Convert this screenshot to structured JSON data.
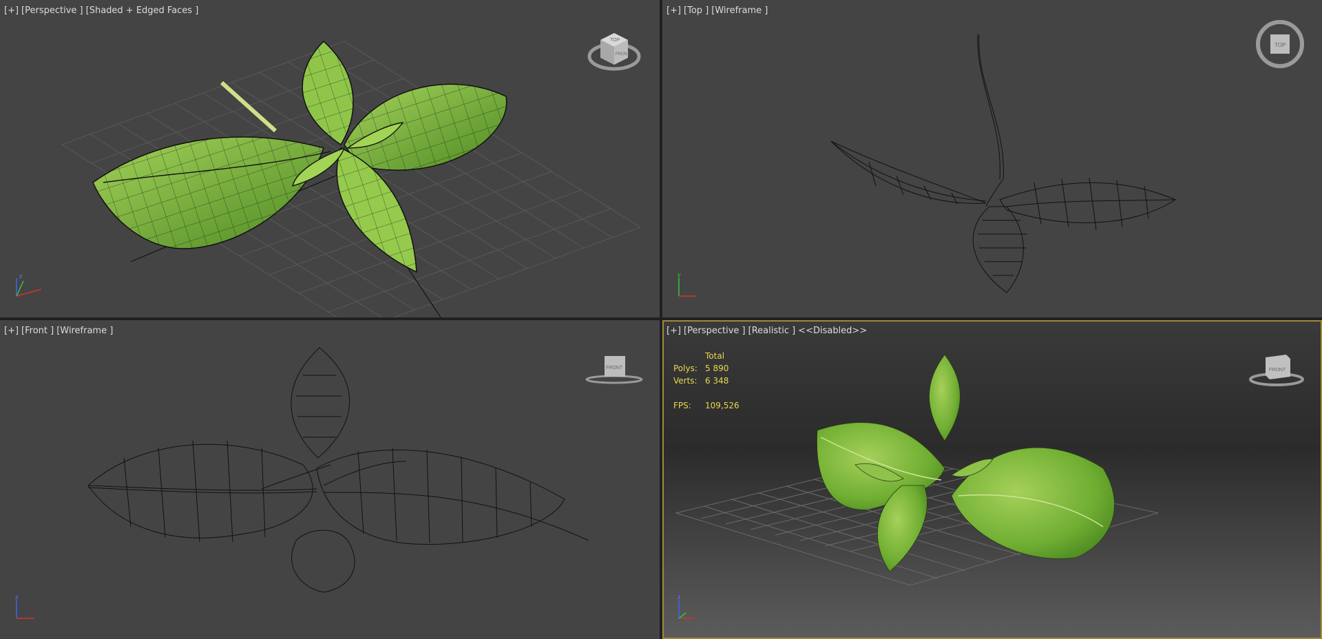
{
  "viewports": {
    "top_left": {
      "plus": "[+]",
      "view": "[Perspective ]",
      "shading": "[Shaded + Edged Faces ]"
    },
    "top_right": {
      "plus": "[+]",
      "view": "[Top ]",
      "shading": "[Wireframe ]"
    },
    "bottom_left": {
      "plus": "[+]",
      "view": "[Front ]",
      "shading": "[Wireframe ]"
    },
    "bottom_right": {
      "plus": "[+]",
      "view": "[Perspective ]",
      "shading": "[Realistic ]",
      "extra": "<<Disabled>>"
    }
  },
  "stats": {
    "header": "Total",
    "polys_label": "Polys:",
    "polys_value": "5 890",
    "verts_label": "Verts:",
    "verts_value": "6 348",
    "fps_label": "FPS:",
    "fps_value": "109,526"
  },
  "viewcube": {
    "perspective_face": "TOP",
    "perspective_side": "FRONT",
    "top_face": "TOP",
    "front_face": "FRONT"
  },
  "axis_labels": {
    "x": "x",
    "y": "y",
    "z": "z"
  },
  "colors": {
    "viewport_bg": "#444444",
    "active_border": "#a08a3c",
    "stats_text": "#e8d84e",
    "leaf_green": "#8cc044",
    "leaf_dark": "#4f8a22",
    "axis_x": "#d23232",
    "axis_y": "#32c832",
    "axis_z": "#3a64ff"
  }
}
